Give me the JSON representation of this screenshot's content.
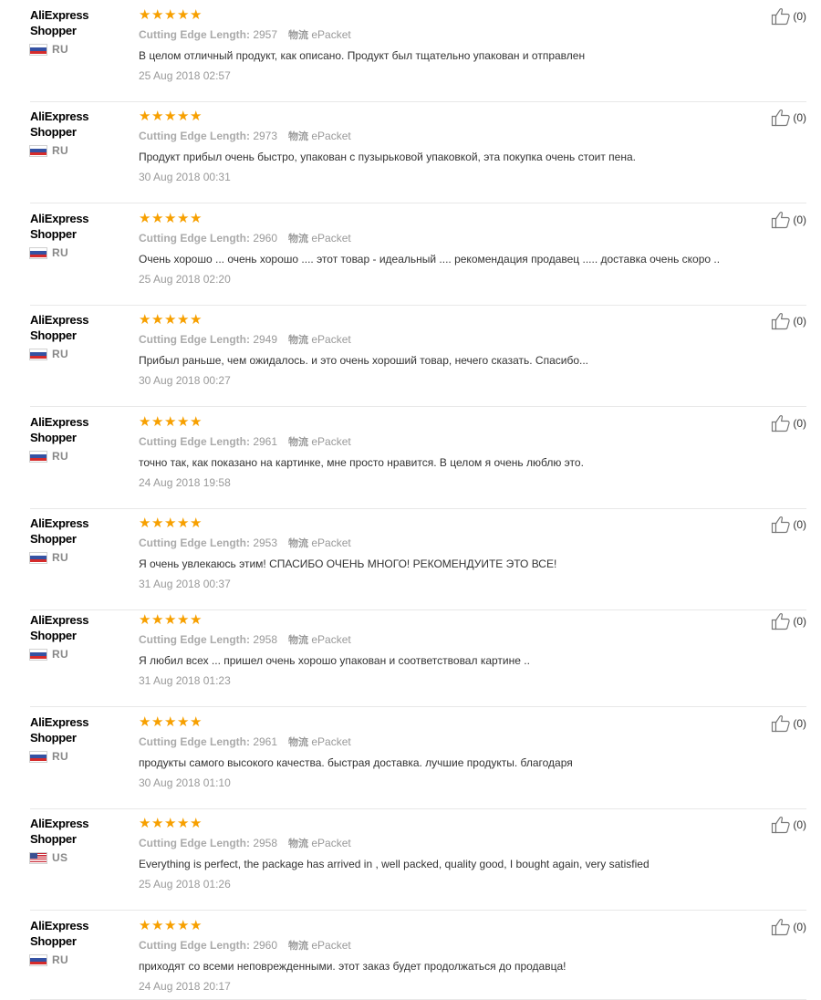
{
  "reviews": [
    {
      "user": "AliExpress Shopper",
      "country": "RU",
      "stars": 5,
      "attr_name": "Cutting Edge Length:",
      "attr_value": "2957",
      "ship_label": "物流",
      "ship_value": "ePacket",
      "text": "В целом отличный продукт, как описано. Продукт был тщательно упакован и отправлен",
      "date": "25 Aug 2018 02:57",
      "helpful": "(0)"
    },
    {
      "user": "AliExpress Shopper",
      "country": "RU",
      "stars": 5,
      "attr_name": "Cutting Edge Length:",
      "attr_value": "2973",
      "ship_label": "物流",
      "ship_value": "ePacket",
      "text": "Продукт прибыл очень быстро, упакован с пузырьковой упаковкой, эта покупка очень стоит пена.",
      "date": "30 Aug 2018 00:31",
      "helpful": "(0)"
    },
    {
      "user": "AliExpress Shopper",
      "country": "RU",
      "stars": 5,
      "attr_name": "Cutting Edge Length:",
      "attr_value": "2960",
      "ship_label": "物流",
      "ship_value": "ePacket",
      "text": "Очень хорошо ... очень хорошо .... этот товар - идеальный .... рекомендация продавец ..... доставка очень скоро ..",
      "date": "25 Aug 2018 02:20",
      "helpful": "(0)"
    },
    {
      "user": "AliExpress Shopper",
      "country": "RU",
      "stars": 5,
      "attr_name": "Cutting Edge Length:",
      "attr_value": "2949",
      "ship_label": "物流",
      "ship_value": "ePacket",
      "text": "Прибыл раньше, чем ожидалось. и это очень хороший товар, нечего сказать. Спасибо...",
      "date": "30 Aug 2018 00:27",
      "helpful": "(0)"
    },
    {
      "user": "AliExpress Shopper",
      "country": "RU",
      "stars": 5,
      "attr_name": "Cutting Edge Length:",
      "attr_value": "2961",
      "ship_label": "物流",
      "ship_value": "ePacket",
      "text": "точно так, как показано на картинке, мне просто нравится. В целом я очень люблю это.",
      "date": "24 Aug 2018 19:58",
      "helpful": "(0)"
    },
    {
      "user": "AliExpress Shopper",
      "country": "RU",
      "stars": 5,
      "attr_name": "Cutting Edge Length:",
      "attr_value": "2953",
      "ship_label": "物流",
      "ship_value": "ePacket",
      "text": "Я очень увлекаюсь этим! СПАСИБО ОЧЕНЬ МНОГО! РЕКОМЕНДУИТЕ ЭТО ВСЕ!",
      "date": "31 Aug 2018 00:37",
      "helpful": "(0)"
    },
    {
      "user": "AliExpress Shopper",
      "country": "RU",
      "stars": 5,
      "attr_name": "Cutting Edge Length:",
      "attr_value": "2958",
      "ship_label": "物流",
      "ship_value": "ePacket",
      "text": "Я любил всех ... пришел очень хорошо упакован и соответствовал картине ..",
      "date": "31 Aug 2018 01:23",
      "helpful": "(0)"
    },
    {
      "user": "AliExpress Shopper",
      "country": "RU",
      "stars": 5,
      "attr_name": "Cutting Edge Length:",
      "attr_value": "2961",
      "ship_label": "物流",
      "ship_value": "ePacket",
      "text": "продукты самого высокого качества. быстрая доставка. лучшие продукты. благодаря",
      "date": "30 Aug 2018 01:10",
      "helpful": "(0)"
    },
    {
      "user": "AliExpress Shopper",
      "country": "US",
      "stars": 5,
      "attr_name": "Cutting Edge Length:",
      "attr_value": "2958",
      "ship_label": "物流",
      "ship_value": "ePacket",
      "text": "Everything is perfect, the package has arrived in , well packed, quality good, I bought again, very satisfied",
      "date": "25 Aug 2018 01:26",
      "helpful": "(0)"
    },
    {
      "user": "AliExpress Shopper",
      "country": "RU",
      "stars": 5,
      "attr_name": "Cutting Edge Length:",
      "attr_value": "2960",
      "ship_label": "物流",
      "ship_value": "ePacket",
      "text": "приходят со всеми неповрежденными. этот заказ будет продолжаться до продавца!",
      "date": "24 Aug 2018 20:17",
      "helpful": "(0)"
    }
  ],
  "colors": {
    "star": "#f7a000",
    "flag_ru": [
      "#ffffff",
      "#3552a3",
      "#d52b2b"
    ],
    "flag_us": [
      "#c8212e",
      "#ffffff",
      "#3a4f91"
    ]
  },
  "icons": {
    "helpful": "thumbs-up-icon",
    "star": "star-icon"
  }
}
